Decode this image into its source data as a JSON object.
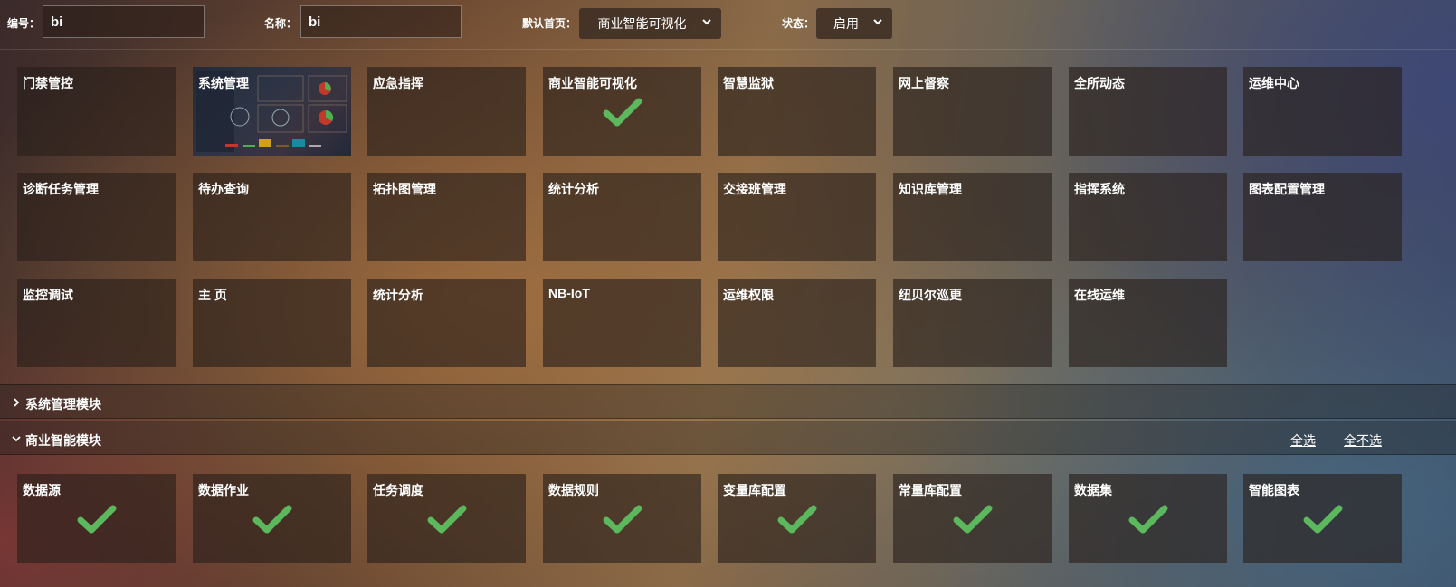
{
  "filters": {
    "code_label": "编号：",
    "code_value": "bi",
    "name_label": "名称：",
    "name_value": "bi",
    "homepage_label": "默认首页：",
    "homepage_value": "商业智能可视化",
    "status_label": "状态：",
    "status_value": "启用"
  },
  "pages": [
    {
      "name": "门禁管控",
      "checked": false
    },
    {
      "name": "系统管理",
      "checked": false,
      "thumbnail": true
    },
    {
      "name": "应急指挥",
      "checked": false
    },
    {
      "name": "商业智能可视化",
      "checked": true
    },
    {
      "name": "智慧监狱",
      "checked": false
    },
    {
      "name": "网上督察",
      "checked": false
    },
    {
      "name": "全所动态",
      "checked": false
    },
    {
      "name": "运维中心",
      "checked": false
    },
    {
      "name": "诊断任务管理",
      "checked": false
    },
    {
      "name": "待办查询",
      "checked": false
    },
    {
      "name": "拓扑图管理",
      "checked": false
    },
    {
      "name": "统计分析",
      "checked": false
    },
    {
      "name": "交接班管理",
      "checked": false
    },
    {
      "name": "知识库管理",
      "checked": false
    },
    {
      "name": "指挥系统",
      "checked": false
    },
    {
      "name": "图表配置管理",
      "checked": false
    },
    {
      "name": "监控调试",
      "checked": false
    },
    {
      "name": "主 页",
      "checked": false
    },
    {
      "name": "统计分析",
      "checked": false
    },
    {
      "name": "NB-IoT",
      "checked": false
    },
    {
      "name": "运维权限",
      "checked": false
    },
    {
      "name": "纽贝尔巡更",
      "checked": false
    },
    {
      "name": "在线运维",
      "checked": false
    }
  ],
  "sections": {
    "system": {
      "title": "系统管理模块",
      "expanded": false
    },
    "bi": {
      "title": "商业智能模块",
      "expanded": true,
      "select_all": "全选",
      "select_none": "全不选"
    }
  },
  "bi_modules": [
    {
      "name": "数据源",
      "checked": true
    },
    {
      "name": "数据作业",
      "checked": true
    },
    {
      "name": "任务调度",
      "checked": true
    },
    {
      "name": "数据规则",
      "checked": true
    },
    {
      "name": "变量库配置",
      "checked": true
    },
    {
      "name": "常量库配置",
      "checked": true
    },
    {
      "name": "数据集",
      "checked": true
    },
    {
      "name": "智能图表",
      "checked": true
    }
  ],
  "colors": {
    "check": "#5cb85c"
  }
}
